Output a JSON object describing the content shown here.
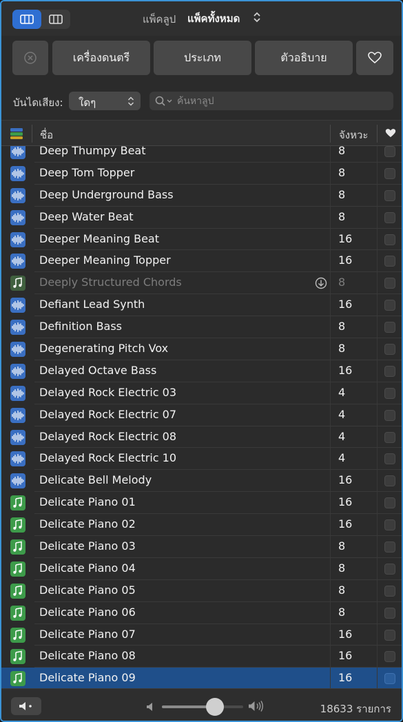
{
  "header": {
    "pack_label": "แพ็คลูป",
    "pack_value": "แพ็คทั้งหมด"
  },
  "filters": {
    "instrument": "เครื่องดนตรี",
    "genre": "ประเภท",
    "descriptor": "ตัวอธิบาย"
  },
  "scale": {
    "label": "บันไดเสียง:",
    "value": "ใดๆ"
  },
  "search": {
    "placeholder": "ค้นหาลูป",
    "value": ""
  },
  "table": {
    "col_name": "ชื่อ",
    "col_beats": "จังหวะ",
    "rows": [
      {
        "name": "Deep Thumpy Beat",
        "beats": "8",
        "type": "audio"
      },
      {
        "name": "Deep Tom Topper",
        "beats": "8",
        "type": "audio"
      },
      {
        "name": "Deep Underground Bass",
        "beats": "8",
        "type": "audio"
      },
      {
        "name": "Deep Water Beat",
        "beats": "8",
        "type": "audio"
      },
      {
        "name": "Deeper Meaning Beat",
        "beats": "16",
        "type": "audio"
      },
      {
        "name": "Deeper Meaning Topper",
        "beats": "16",
        "type": "audio"
      },
      {
        "name": "Deeply Structured Chords",
        "beats": "8",
        "type": "midi",
        "dim": true,
        "download": true
      },
      {
        "name": "Defiant Lead Synth",
        "beats": "16",
        "type": "audio"
      },
      {
        "name": "Definition Bass",
        "beats": "8",
        "type": "audio"
      },
      {
        "name": "Degenerating Pitch Vox",
        "beats": "8",
        "type": "audio"
      },
      {
        "name": "Delayed Octave Bass",
        "beats": "16",
        "type": "audio"
      },
      {
        "name": "Delayed Rock Electric 03",
        "beats": "4",
        "type": "audio"
      },
      {
        "name": "Delayed Rock Electric 07",
        "beats": "4",
        "type": "audio"
      },
      {
        "name": "Delayed Rock Electric 08",
        "beats": "4",
        "type": "audio"
      },
      {
        "name": "Delayed Rock Electric 10",
        "beats": "4",
        "type": "audio"
      },
      {
        "name": "Delicate Bell Melody",
        "beats": "16",
        "type": "audio"
      },
      {
        "name": "Delicate Piano 01",
        "beats": "16",
        "type": "midi"
      },
      {
        "name": "Delicate Piano 02",
        "beats": "16",
        "type": "midi"
      },
      {
        "name": "Delicate Piano 03",
        "beats": "8",
        "type": "midi"
      },
      {
        "name": "Delicate Piano 04",
        "beats": "8",
        "type": "midi"
      },
      {
        "name": "Delicate Piano 05",
        "beats": "8",
        "type": "midi"
      },
      {
        "name": "Delicate Piano 06",
        "beats": "8",
        "type": "midi"
      },
      {
        "name": "Delicate Piano 07",
        "beats": "16",
        "type": "midi"
      },
      {
        "name": "Delicate Piano 08",
        "beats": "16",
        "type": "midi"
      },
      {
        "name": "Delicate Piano 09",
        "beats": "16",
        "type": "midi",
        "selected": true
      }
    ]
  },
  "footer": {
    "volume": 0.65,
    "count": "18633 รายการ"
  },
  "colors": {
    "accent": "#2f6fd2",
    "audio_icon": "#3a6fc2",
    "midi_icon": "#3d9b4a",
    "selected_row": "#1f4f8a"
  }
}
